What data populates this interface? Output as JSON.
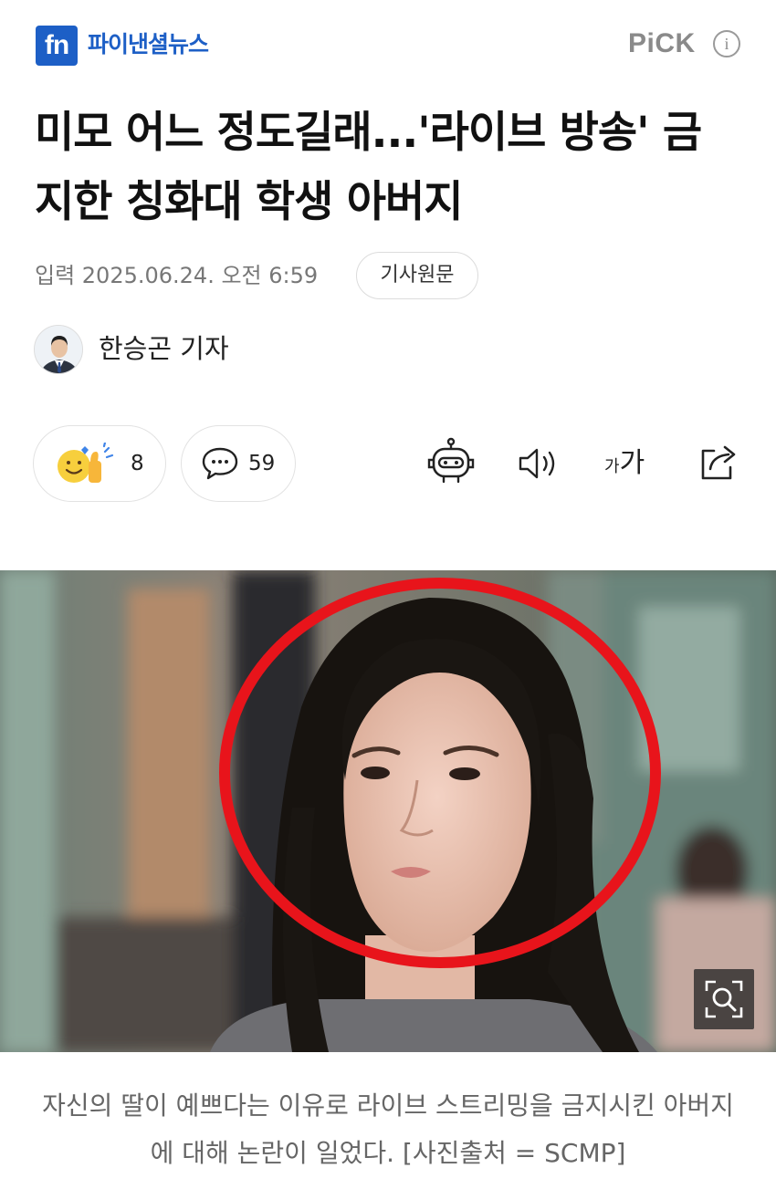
{
  "header": {
    "logo_mark": "fn",
    "logo_name": "파이낸셜뉴스",
    "pick_label": "PiCK",
    "info_label": "i"
  },
  "article": {
    "headline": "미모 어느 정도길래...'라이브 방송' 금지한 칭화대 학생 아버지",
    "date": "입력 2025.06.24. 오전 6:59",
    "original_button": "기사원문",
    "reporter": "한승곤 기자"
  },
  "actions": {
    "reaction_count": "8",
    "comment_count": "59",
    "font_small": "가",
    "font_big": "가"
  },
  "icons": {
    "reaction": "reaction-emoji-icon",
    "comment": "speech-bubble-icon",
    "summary": "robot-icon",
    "listen": "speaker-icon",
    "font": "font-size-icon",
    "share": "share-icon",
    "zoom": "magnifier-icon"
  },
  "colors": {
    "brand": "#1d5fc6",
    "highlight_circle": "#e8141b"
  },
  "photo": {
    "caption": "자신의 딸이 예쁘다는 이유로 라이브 스트리밍을 금지시킨 아버지에 대해 논란이 일었다. [사진출처 = SCMP]"
  }
}
